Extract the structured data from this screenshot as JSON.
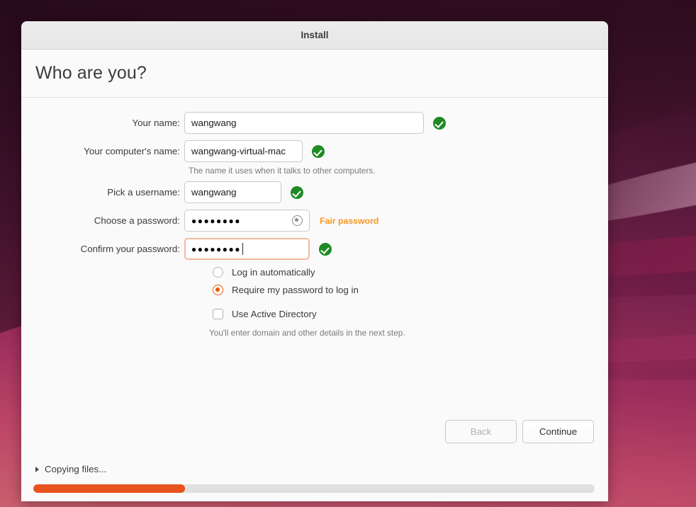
{
  "window": {
    "title": "Install",
    "page_title": "Who are you?"
  },
  "form": {
    "name": {
      "label": "Your name:",
      "value": "wangwang",
      "valid": "valid-check-icon"
    },
    "hostname": {
      "label": "Your computer's name:",
      "value": "wangwang-virtual-mac",
      "hint": "The name it uses when it talks to other computers.",
      "valid": "valid-check-icon"
    },
    "username": {
      "label": "Pick a username:",
      "value": "wangwang",
      "valid": "valid-check-icon"
    },
    "password": {
      "label": "Choose a password:",
      "value": "●●●●●●●●",
      "reveal_icon": "eye-reveal-icon",
      "strength": "Fair password",
      "strength_color": "#f9951e"
    },
    "confirm": {
      "label": "Confirm your password:",
      "value": "●●●●●●●●",
      "focused": true,
      "valid": "valid-check-icon"
    }
  },
  "options": {
    "login_auto": {
      "label": "Log in automatically",
      "selected": false
    },
    "login_password": {
      "label": "Require my password to log in",
      "selected": true,
      "accent": "#e8590c"
    },
    "active_directory": {
      "label": "Use Active Directory",
      "checked": false,
      "hint": "You'll enter domain and other details in the next step."
    }
  },
  "buttons": {
    "back": "Back",
    "continue": "Continue"
  },
  "progress": {
    "status": "Copying files...",
    "percent": 27,
    "bar_color": "#e8521f",
    "expander_icon": "chevron-right-icon"
  }
}
